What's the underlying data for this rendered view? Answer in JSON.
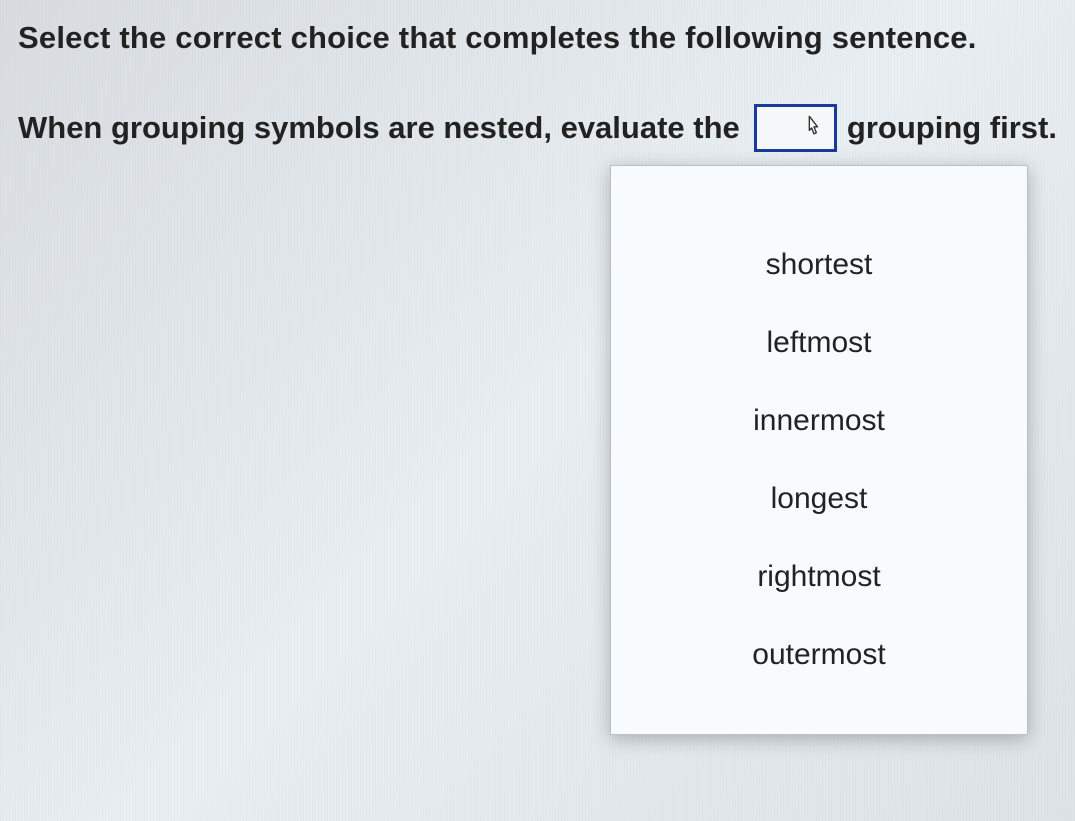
{
  "instruction": "Select the correct choice that completes the following sentence.",
  "sentence": {
    "before": "When grouping symbols are nested, evaluate the",
    "after": "grouping first."
  },
  "dropdown": {
    "options": [
      "shortest",
      "leftmost",
      "innermost",
      "longest",
      "rightmost",
      "outermost"
    ]
  }
}
